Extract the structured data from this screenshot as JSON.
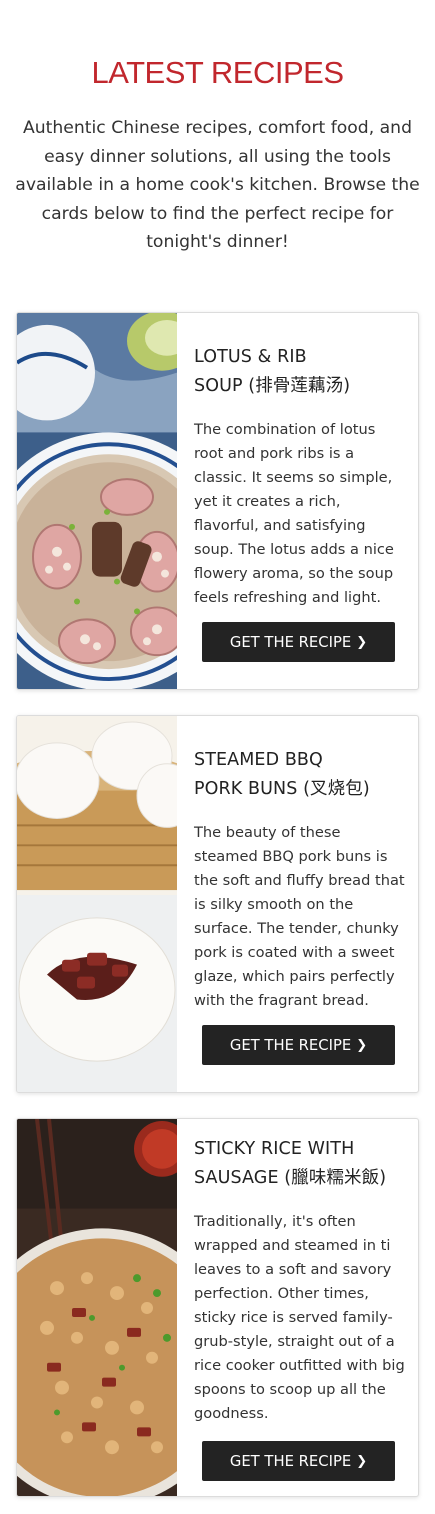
{
  "section": {
    "title": "LATEST RECIPES",
    "intro": "Authentic Chinese recipes, comfort food, and easy dinner solutions, all using the tools available in a home cook's kitchen. Browse the cards below to find the perfect recipe for tonight's dinner!"
  },
  "recipes": [
    {
      "title_line1": "LOTUS & RIB",
      "title_line2": "SOUP (排骨莲藕汤)",
      "description": "The combination of lotus root and pork ribs is a classic. It seems so simple, yet it creates a rich, flavorful, and satisfying soup. The lotus adds a nice flowery aroma, so the soup feels refreshing and light.",
      "button_label": "GET THE RECIPE",
      "button_icon": "chevron-right-icon"
    },
    {
      "title_line1": "STEAMED BBQ",
      "title_line2": "PORK BUNS (叉烧包)",
      "description": "The beauty of these steamed BBQ pork buns is the soft and fluffy bread that is silky smooth on the surface. The tender, chunky pork is coated with a sweet glaze, which pairs perfectly with the fragrant bread.",
      "button_label": "GET THE RECIPE",
      "button_icon": "chevron-right-icon"
    },
    {
      "title_line1": "STICKY RICE WITH",
      "title_line2": "SAUSAGE (臘味糯米飯)",
      "description": "Traditionally, it's often wrapped and steamed in ti leaves to a soft and savory perfection. Other times, sticky rice is served family-grub-style, straight out of a rice cooker outfitted with big spoons to scoop up all the goodness.",
      "button_label": "GET THE RECIPE",
      "button_icon": "chevron-right-icon"
    }
  ],
  "colors": {
    "heading": "#c1272d",
    "button_bg": "#232323",
    "button_text": "#ffffff"
  }
}
